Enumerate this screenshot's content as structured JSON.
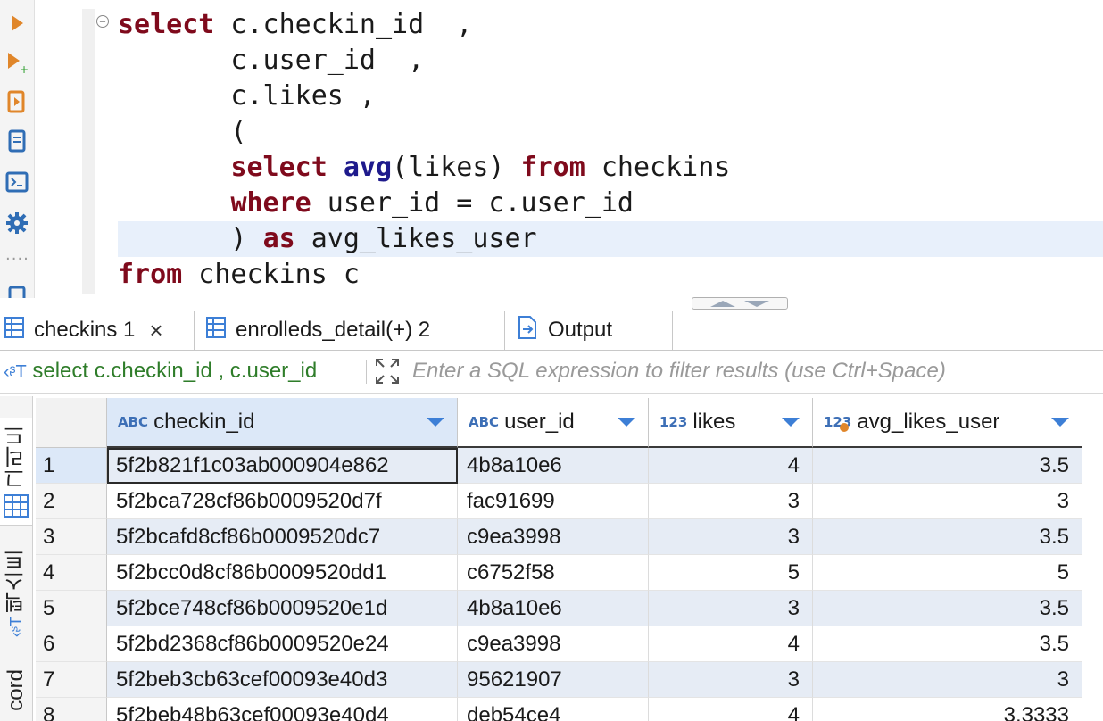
{
  "editor": {
    "lines": [
      [
        {
          "t": "select",
          "c": "kw"
        },
        {
          "t": " c.checkin_id  ,"
        }
      ],
      [
        {
          "t": "       c.user_id  ,"
        }
      ],
      [
        {
          "t": "       c.likes ,"
        }
      ],
      [
        {
          "t": "       ("
        }
      ],
      [
        {
          "t": "       "
        },
        {
          "t": "select",
          "c": "kw"
        },
        {
          "t": " "
        },
        {
          "t": "avg",
          "c": "fn"
        },
        {
          "t": "(likes) "
        },
        {
          "t": "from",
          "c": "kw"
        },
        {
          "t": " checkins"
        }
      ],
      [
        {
          "t": "       "
        },
        {
          "t": "where",
          "c": "kw"
        },
        {
          "t": " user_id = c.user_id"
        }
      ],
      [
        {
          "t": "       ) "
        },
        {
          "t": "as",
          "c": "kw"
        },
        {
          "t": " avg_likes_user"
        }
      ],
      [
        {
          "t": "from",
          "c": "kw"
        },
        {
          "t": " checkins c"
        }
      ]
    ],
    "highlighted_line": 6,
    "collapse_glyph": "−"
  },
  "tabs": {
    "items": [
      {
        "label": "checkins 1",
        "icon": "grid-table-icon",
        "active": true,
        "closable": true
      },
      {
        "label": "enrolleds_detail(+) 2",
        "icon": "grid-table-icon",
        "active": false,
        "closable": false
      },
      {
        "label": "Output",
        "icon": "output-icon",
        "active": false,
        "closable": false
      }
    ],
    "close_glyph": "×"
  },
  "filter": {
    "query_text": "select c.checkin_id , c.user_id",
    "placeholder": "Enter a SQL expression to filter results (use Ctrl+Space)"
  },
  "side_tabs": {
    "grid_label": "그리드",
    "text_label": "텍스트",
    "record_label": "cord"
  },
  "grid": {
    "columns": [
      {
        "name": "checkin_id",
        "type": "ABC"
      },
      {
        "name": "user_id",
        "type": "ABC"
      },
      {
        "name": "likes",
        "type": "123"
      },
      {
        "name": "avg_likes_user",
        "type": "123"
      }
    ],
    "rows": [
      {
        "n": "1",
        "checkin_id": "5f2b821f1c03ab000904e862",
        "user_id": "4b8a10e6",
        "likes": "4",
        "avg": "3.5"
      },
      {
        "n": "2",
        "checkin_id": "5f2bca728cf86b0009520d7f",
        "user_id": "fac91699",
        "likes": "3",
        "avg": "3"
      },
      {
        "n": "3",
        "checkin_id": "5f2bcafd8cf86b0009520dc7",
        "user_id": "c9ea3998",
        "likes": "3",
        "avg": "3.5"
      },
      {
        "n": "4",
        "checkin_id": "5f2bcc0d8cf86b0009520dd1",
        "user_id": "c6752f58",
        "likes": "5",
        "avg": "5"
      },
      {
        "n": "5",
        "checkin_id": "5f2bce748cf86b0009520e1d",
        "user_id": "4b8a10e6",
        "likes": "3",
        "avg": "3.5"
      },
      {
        "n": "6",
        "checkin_id": "5f2bd2368cf86b0009520e24",
        "user_id": "c9ea3998",
        "likes": "4",
        "avg": "3.5"
      },
      {
        "n": "7",
        "checkin_id": "5f2beb3cb63cef00093e40d3",
        "user_id": "95621907",
        "likes": "3",
        "avg": "3"
      },
      {
        "n": "8",
        "checkin_id": "5f2beb48b63cef00093e40d4",
        "user_id": "deb54ce4",
        "likes": "4",
        "avg": "3.3333"
      }
    ]
  },
  "colors": {
    "keyword": "#7f0a1c",
    "function": "#1e1a8c",
    "filter_text": "#2f7d2a",
    "type_badge": "#3d6fb6",
    "selected_header": "#dce8f8",
    "alt_row": "#e6ecf5"
  }
}
